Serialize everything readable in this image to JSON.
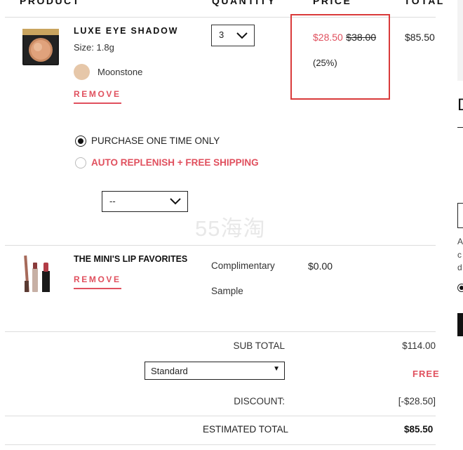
{
  "header": {
    "product": "PRODUCT",
    "quantity": "QUANTITY",
    "price": "PRICE",
    "total": "TOTAL"
  },
  "items": [
    {
      "name": "LUXE EYE SHADOW",
      "size": "Size: 1.8g",
      "shade_name": "Moonstone",
      "shade_color": "#e6c7a9",
      "remove_label": "REMOVE",
      "quantity": "3",
      "sale_price": "$28.50",
      "original_price": "$38.00",
      "discount_pct": "(25%)",
      "total": "$85.50",
      "purchase_options": {
        "one_time": "PURCHASE ONE TIME ONLY",
        "replenish": "AUTO REPLENISH + FREE SHIPPING",
        "frequency_value": "--"
      }
    },
    {
      "name": "THE MINI'S LIP FAVORITES",
      "remove_label": "REMOVE",
      "qty_line1": "Complimentary",
      "qty_line2": "Sample",
      "price": "$0.00"
    }
  ],
  "watermark": "55海淘",
  "summary": {
    "subtotal_label": "SUB TOTAL",
    "subtotal_value": "$114.00",
    "shipping_method": "Standard",
    "shipping_value": "FREE",
    "discount_label": "DISCOUNT:",
    "discount_value": "[-$28.50]",
    "estimated_label": "ESTIMATED TOTAL",
    "estimated_value": "$85.50"
  },
  "right_panel": {
    "heading_fragment": "D",
    "text_fragments": [
      "A",
      "c",
      "d"
    ]
  },
  "colors": {
    "accent": "#e0505e",
    "highlight_box": "#d93a3a"
  }
}
